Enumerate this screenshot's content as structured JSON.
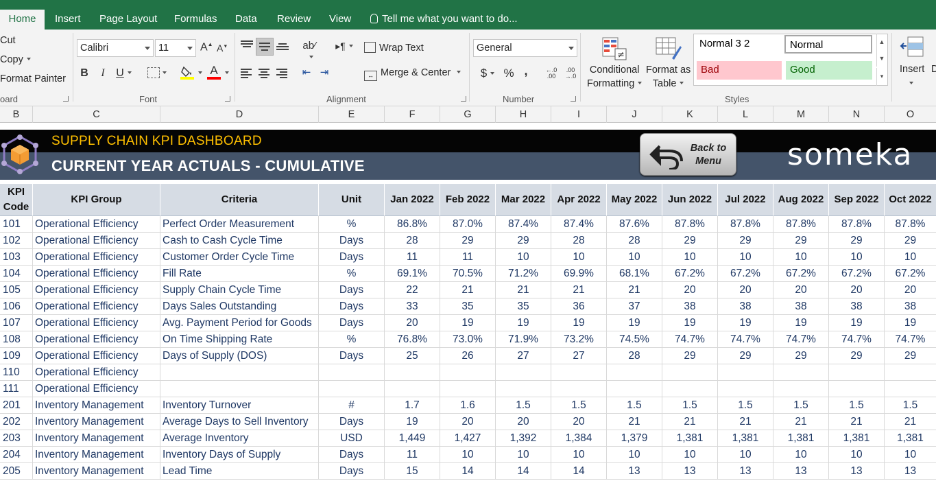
{
  "tabs": [
    {
      "label": "Home",
      "active": true
    },
    {
      "label": "Insert"
    },
    {
      "label": "Page Layout"
    },
    {
      "label": "Formulas"
    },
    {
      "label": "Data"
    },
    {
      "label": "Review"
    },
    {
      "label": "View"
    }
  ],
  "tell_me": "Tell me what you want to do...",
  "clipboard": {
    "cut": "Cut",
    "copy": "Copy",
    "format_painter": "Format Painter",
    "label": "oard"
  },
  "font": {
    "name": "Calibri",
    "size": "11",
    "label": "Font",
    "bold": "B",
    "italic": "I",
    "underline": "U"
  },
  "alignment": {
    "wrap_text": "Wrap Text",
    "merge_center": "Merge & Center",
    "label": "Alignment"
  },
  "number": {
    "format": "General",
    "currency": "$",
    "percent": "%",
    "comma": ",",
    "inc_decimal": "←.0 .00",
    "dec_decimal": ".00 →.0",
    "label": "Number"
  },
  "styles": {
    "conditional": [
      "Conditional",
      "Formatting"
    ],
    "format_as": [
      "Format as",
      "Table"
    ],
    "normal32": "Normal 3 2",
    "normal": "Normal",
    "bad": "Bad",
    "good": "Good",
    "label": "Styles"
  },
  "cells": {
    "insert": "Insert",
    "d": "D"
  },
  "columns": [
    "B",
    "C",
    "D",
    "E",
    "F",
    "G",
    "H",
    "I",
    "J",
    "K",
    "L",
    "M",
    "N",
    "O"
  ],
  "banner": {
    "title": "SUPPLY CHAIN KPI DASHBOARD",
    "subtitle": "CURRENT YEAR ACTUALS - CUMULATIVE",
    "back_button": [
      "Back to",
      "Menu"
    ],
    "brand": "someka"
  },
  "table": {
    "headers": [
      "KPI Code",
      "KPI Group",
      "Criteria",
      "Unit",
      "Jan 2022",
      "Feb 2022",
      "Mar 2022",
      "Apr 2022",
      "May 2022",
      "Jun 2022",
      "Jul 2022",
      "Aug 2022",
      "Sep 2022",
      "Oct 2022"
    ],
    "rows": [
      [
        "101",
        "Operational Efficiency",
        "Perfect Order Measurement",
        "%",
        "86.8%",
        "87.0%",
        "87.4%",
        "87.4%",
        "87.6%",
        "87.8%",
        "87.8%",
        "87.8%",
        "87.8%",
        "87.8%"
      ],
      [
        "102",
        "Operational Efficiency",
        "Cash to Cash Cycle Time",
        "Days",
        "28",
        "29",
        "29",
        "28",
        "28",
        "29",
        "29",
        "29",
        "29",
        "29"
      ],
      [
        "103",
        "Operational Efficiency",
        "Customer Order Cycle Time",
        "Days",
        "11",
        "11",
        "10",
        "10",
        "10",
        "10",
        "10",
        "10",
        "10",
        "10"
      ],
      [
        "104",
        "Operational Efficiency",
        "Fill Rate",
        "%",
        "69.1%",
        "70.5%",
        "71.2%",
        "69.9%",
        "68.1%",
        "67.2%",
        "67.2%",
        "67.2%",
        "67.2%",
        "67.2%"
      ],
      [
        "105",
        "Operational Efficiency",
        "Supply Chain Cycle Time",
        "Days",
        "22",
        "21",
        "21",
        "21",
        "21",
        "20",
        "20",
        "20",
        "20",
        "20"
      ],
      [
        "106",
        "Operational Efficiency",
        "Days Sales Outstanding",
        "Days",
        "33",
        "35",
        "35",
        "36",
        "37",
        "38",
        "38",
        "38",
        "38",
        "38"
      ],
      [
        "107",
        "Operational Efficiency",
        "Avg. Payment Period for Goods",
        "Days",
        "20",
        "19",
        "19",
        "19",
        "19",
        "19",
        "19",
        "19",
        "19",
        "19"
      ],
      [
        "108",
        "Operational Efficiency",
        "On Time Shipping Rate",
        "%",
        "76.8%",
        "73.0%",
        "71.9%",
        "73.2%",
        "74.5%",
        "74.7%",
        "74.7%",
        "74.7%",
        "74.7%",
        "74.7%"
      ],
      [
        "109",
        "Operational Efficiency",
        "Days of Supply (DOS)",
        "Days",
        "25",
        "26",
        "27",
        "27",
        "28",
        "29",
        "29",
        "29",
        "29",
        "29"
      ],
      [
        "110",
        "Operational Efficiency",
        "",
        "",
        "",
        "",
        "",
        "",
        "",
        "",
        "",
        "",
        "",
        ""
      ],
      [
        "111",
        "Operational Efficiency",
        "",
        "",
        "",
        "",
        "",
        "",
        "",
        "",
        "",
        "",
        "",
        ""
      ],
      [
        "201",
        "Inventory Management",
        "Inventory Turnover",
        "#",
        "1.7",
        "1.6",
        "1.5",
        "1.5",
        "1.5",
        "1.5",
        "1.5",
        "1.5",
        "1.5",
        "1.5"
      ],
      [
        "202",
        "Inventory Management",
        "Average Days to Sell Inventory",
        "Days",
        "19",
        "20",
        "20",
        "20",
        "21",
        "21",
        "21",
        "21",
        "21",
        "21"
      ],
      [
        "203",
        "Inventory Management",
        "Average Inventory",
        "USD",
        "1,449",
        "1,427",
        "1,392",
        "1,384",
        "1,379",
        "1,381",
        "1,381",
        "1,381",
        "1,381",
        "1,381"
      ],
      [
        "204",
        "Inventory Management",
        "Inventory Days of Supply",
        "Days",
        "11",
        "10",
        "10",
        "10",
        "10",
        "10",
        "10",
        "10",
        "10",
        "10"
      ],
      [
        "205",
        "Inventory Management",
        "Lead Time",
        "Days",
        "15",
        "14",
        "14",
        "14",
        "13",
        "13",
        "13",
        "13",
        "13",
        "13"
      ]
    ]
  },
  "colors": {
    "excel_green": "#217346",
    "header_fill": "#d6dce4",
    "banner_dark": "#44546a",
    "title_gold": "#ffc000",
    "cell_text": "#1f3864",
    "bad_fill": "#ffc7ce",
    "bad_text": "#9c0006",
    "good_fill": "#c6efce",
    "good_text": "#006100"
  }
}
